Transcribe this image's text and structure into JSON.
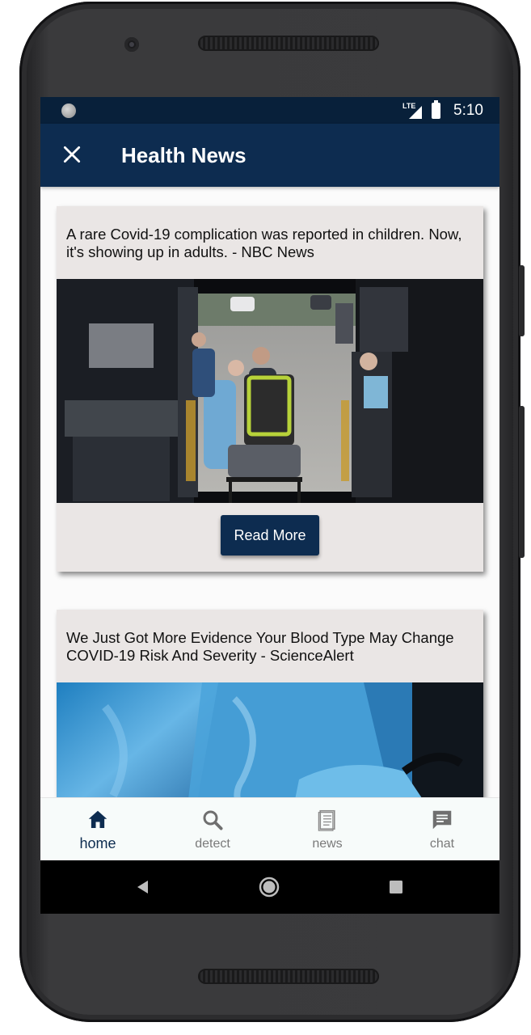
{
  "status_bar": {
    "network": "LTE",
    "time": "5:10"
  },
  "app_bar": {
    "title": "Health News"
  },
  "articles": [
    {
      "title": "A rare Covid-19 complication was reported in children. Now, it's showing up in adults. - NBC News",
      "button_label": "Read More"
    },
    {
      "title": "We Just Got More Evidence Your Blood Type May Change COVID-19 Risk And Severity - ScienceAlert"
    }
  ],
  "bottom_nav": {
    "items": [
      {
        "label": "home",
        "icon": "home-icon",
        "active": true
      },
      {
        "label": "detect",
        "icon": "search-icon",
        "active": false
      },
      {
        "label": "news",
        "icon": "news-icon",
        "active": false
      },
      {
        "label": "chat",
        "icon": "chat-icon",
        "active": false
      }
    ]
  },
  "colors": {
    "primary": "#0d2c50",
    "status_bar": "#08203a",
    "card_bg": "#eae6e5",
    "inactive_nav": "#7a7a7a"
  }
}
